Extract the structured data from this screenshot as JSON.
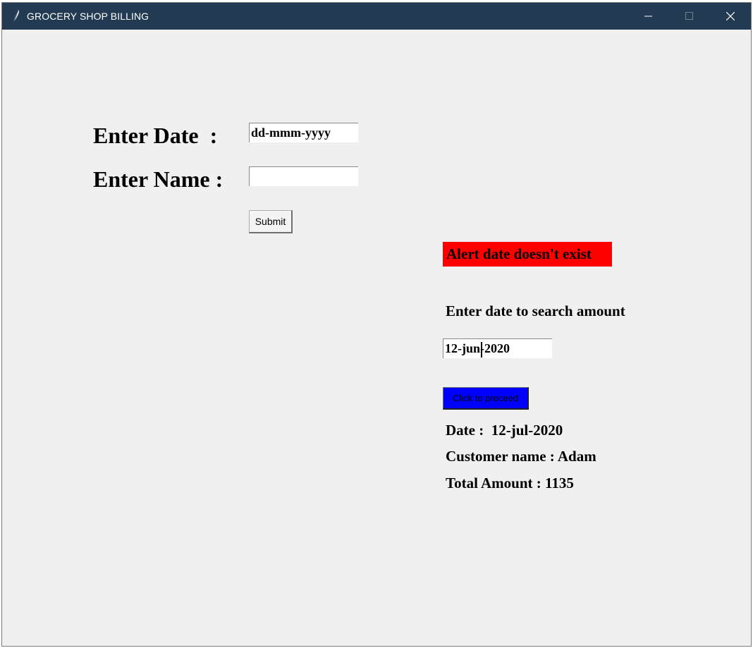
{
  "window": {
    "title": "GROCERY SHOP BILLING"
  },
  "form": {
    "date_label": "Enter Date  :",
    "date_value": "dd-mmm-yyyy",
    "name_label": "Enter Name :",
    "name_value": "",
    "submit_label": "Submit"
  },
  "alert": {
    "text": "Alert date doesn't exist",
    "color": "#ff0000"
  },
  "search": {
    "label": "Enter date to search amount",
    "value": "12-jun-2020",
    "proceed_label": "Click to proceed",
    "proceed_color": "#0000ff"
  },
  "result": {
    "date_line": "Date :  12-jul-2020",
    "customer_line": "Customer name : Adam",
    "total_line": "Total Amount : 1135"
  },
  "icons": {
    "app": "feather-icon",
    "minimize": "minimize-icon",
    "maximize": "maximize-icon",
    "close": "close-icon"
  },
  "colors": {
    "titlebar": "#223a52",
    "window_bg": "#f0f0f0"
  }
}
